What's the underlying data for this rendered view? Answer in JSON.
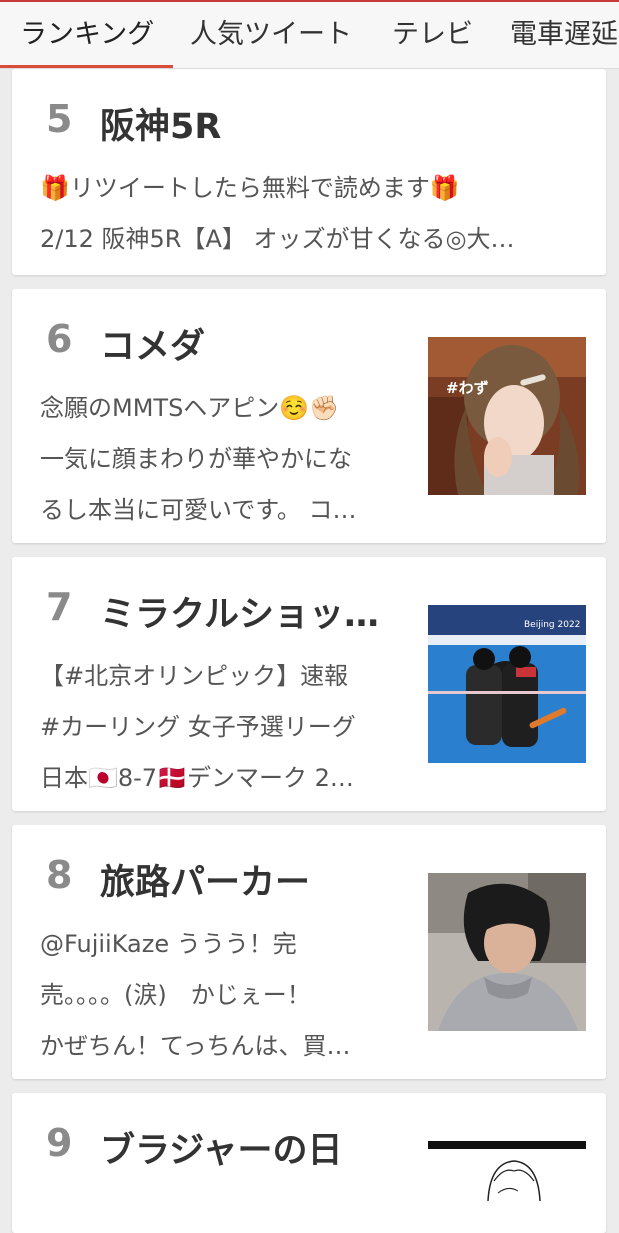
{
  "tabs": [
    {
      "label": "ランキング",
      "active": true
    },
    {
      "label": "人気ツイート"
    },
    {
      "label": "テレビ"
    },
    {
      "label": "電車遅延"
    }
  ],
  "items": [
    {
      "rank": "5",
      "title": "阪神5R",
      "lines": [
        "🎁リツイートしたら無料で読めます🎁",
        "2/12 阪神5R【A】 オッズが甘くなる◎大…"
      ]
    },
    {
      "rank": "6",
      "title": "コメダ",
      "lines": [
        "念願のMMTSヘアピン☺️✊🏻",
        "一気に顔まわりが華やかにな",
        "るし本当に可愛いです。 コ…"
      ],
      "thumb_icon": "woman-photo-icon",
      "thumb_text": "#わず"
    },
    {
      "rank": "7",
      "title": "ミラクルショッ…",
      "lines": [
        "【#北京オリンピック】速報",
        "#カーリング 女子予選リーグ",
        "日本🇯🇵8-7🇩🇰デンマーク 2…"
      ],
      "thumb_icon": "curling-photo-icon",
      "thumb_text": "Beijing 2022"
    },
    {
      "rank": "8",
      "title": "旅路パーカー",
      "lines": [
        "@FujiiKaze ううう！完",
        "売。。。。(涙)　かじぇー！",
        "かぜちん！てっちんは、買…"
      ],
      "thumb_icon": "man-photo-icon"
    },
    {
      "rank": "9",
      "title": "ブラジャーの日",
      "lines": [],
      "thumb_icon": "manga-illustration-icon"
    }
  ],
  "colors": {
    "accent": "#d84c3a",
    "rank": "#8a8a8a",
    "background": "#ececec"
  }
}
